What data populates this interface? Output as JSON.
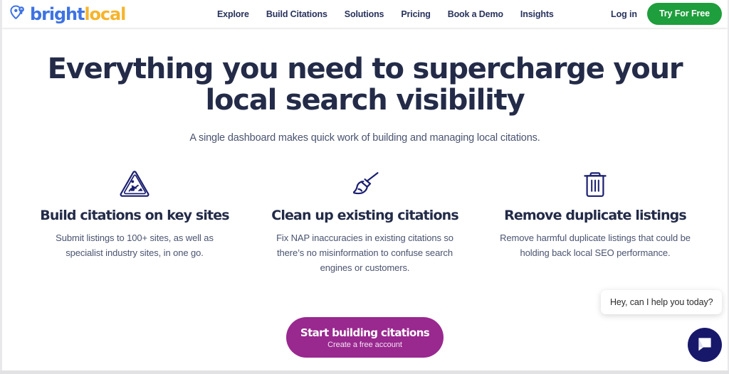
{
  "header": {
    "logo": {
      "icon": "location-pin-icon",
      "text_primary": "bright",
      "text_secondary": "local",
      "color_primary": "#3f73e3",
      "color_secondary": "#f6b42c"
    },
    "nav": [
      {
        "label": "Explore"
      },
      {
        "label": "Build Citations"
      },
      {
        "label": "Solutions"
      },
      {
        "label": "Pricing"
      },
      {
        "label": "Book a Demo"
      },
      {
        "label": "Insights"
      }
    ],
    "login_label": "Log in",
    "try_free_label": "Try For Free",
    "try_free_color": "#1e9e3c"
  },
  "hero": {
    "title": "Everything you need to supercharge your local search visibility",
    "subtitle": "A single dashboard makes quick work of building and managing local citations."
  },
  "features": [
    {
      "icon": "roadworks-warning-sign-icon",
      "title": "Build citations on key sites",
      "description": "Submit listings to 100+ sites, as well as specialist industry sites, in one go."
    },
    {
      "icon": "broom-icon",
      "title": "Clean up existing citations",
      "description": "Fix NAP inaccuracies in existing citations so there’s no misinformation to confuse search engines or customers."
    },
    {
      "icon": "trash-can-icon",
      "title": "Remove duplicate listings",
      "description": "Remove harmful duplicate listings that could be holding back local SEO performance."
    }
  ],
  "cta": {
    "label": "Start building citations",
    "sublabel": "Create a free account",
    "color": "#99288f"
  },
  "chat": {
    "tooltip": "Hey, can I help you today?",
    "launcher_icon": "chat-bubble-icon",
    "launcher_color": "#18186b"
  },
  "colors": {
    "heading": "#232b48",
    "body": "#4a5470",
    "icon": "#1b1f70"
  }
}
